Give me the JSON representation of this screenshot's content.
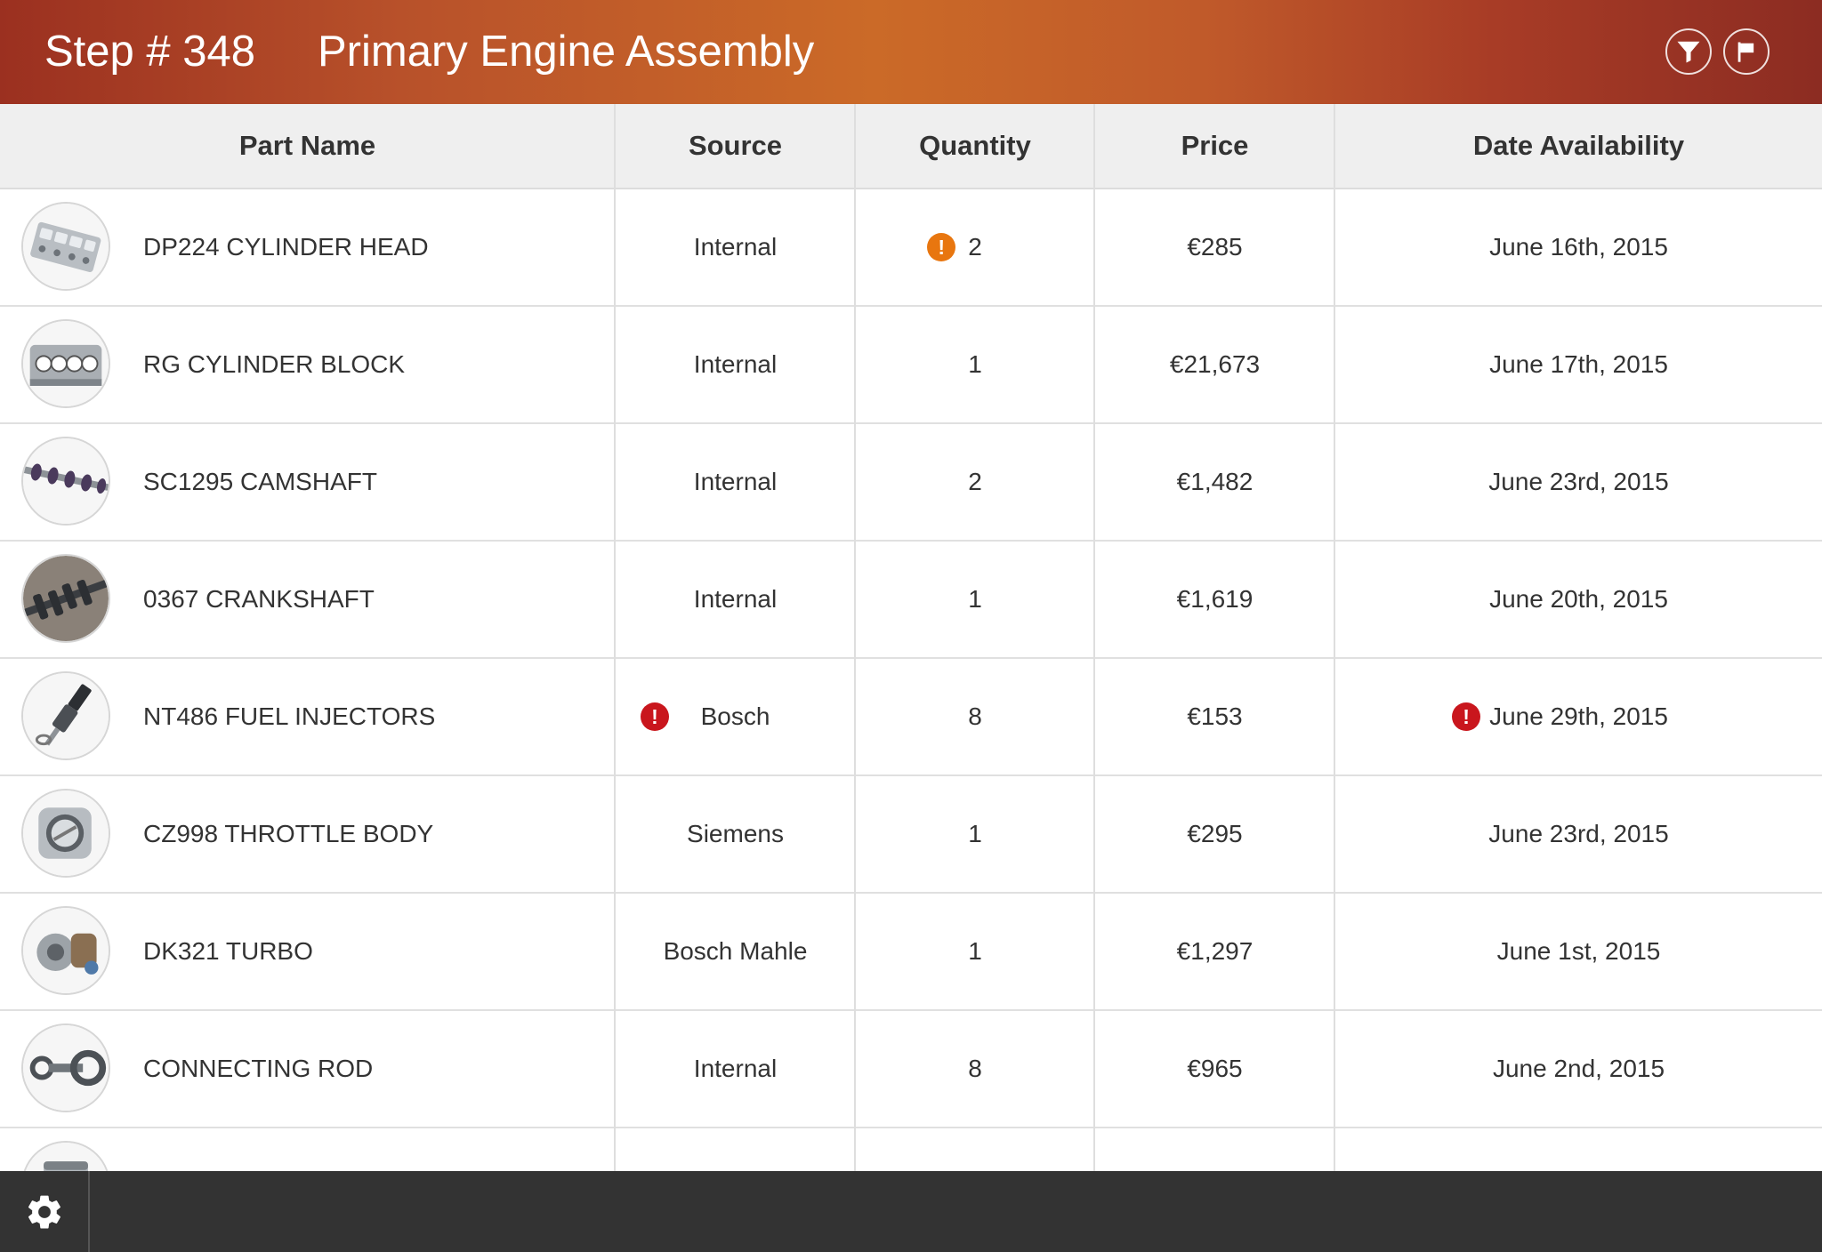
{
  "header": {
    "step": "Step # 348",
    "title": "Primary Engine Assembly",
    "filter_icon": "filter-icon",
    "flag_icon": "flag-icon"
  },
  "columns": {
    "part_name": "Part Name",
    "source": "Source",
    "quantity": "Quantity",
    "price": "Price",
    "date": "Date Availability"
  },
  "rows": [
    {
      "name": "DP224 CYLINDER HEAD",
      "source": "Internal",
      "quantity": "2",
      "price": "€285",
      "date": "June 16th, 2015",
      "quantity_alert": "warning"
    },
    {
      "name": "RG CYLINDER BLOCK",
      "source": "Internal",
      "quantity": "1",
      "price": "€21,673",
      "date": "June 17th, 2015"
    },
    {
      "name": "SC1295 CAMSHAFT",
      "source": "Internal",
      "quantity": "2",
      "price": "€1,482",
      "date": "June 23rd, 2015"
    },
    {
      "name": "0367 CRANKSHAFT",
      "source": "Internal",
      "quantity": "1",
      "price": "€1,619",
      "date": "June 20th, 2015"
    },
    {
      "name": "NT486 FUEL INJECTORS",
      "source": "Bosch",
      "quantity": "8",
      "price": "€153",
      "date": "June 29th, 2015",
      "source_alert": "error",
      "date_alert": "error"
    },
    {
      "name": "CZ998 THROTTLE BODY",
      "source": "Siemens",
      "quantity": "1",
      "price": "€295",
      "date": "June 23rd, 2015"
    },
    {
      "name": "DK321 TURBO",
      "source": "Bosch Mahle",
      "quantity": "1",
      "price": "€1,297",
      "date": "June 1st, 2015"
    },
    {
      "name": "CONNECTING ROD",
      "source": "Internal",
      "quantity": "8",
      "price": "€965",
      "date": "June 2nd, 2015"
    },
    {
      "name": "",
      "source": "",
      "quantity": "",
      "price": "",
      "date": ""
    }
  ],
  "alert_glyph": "!",
  "colors": {
    "header_gradient": [
      "#9b3020",
      "#cb6a28",
      "#8c2c22"
    ],
    "warning": "#e8760f",
    "error": "#c9161d",
    "footer": "#333333"
  },
  "footer": {
    "settings_icon": "gear-icon"
  }
}
